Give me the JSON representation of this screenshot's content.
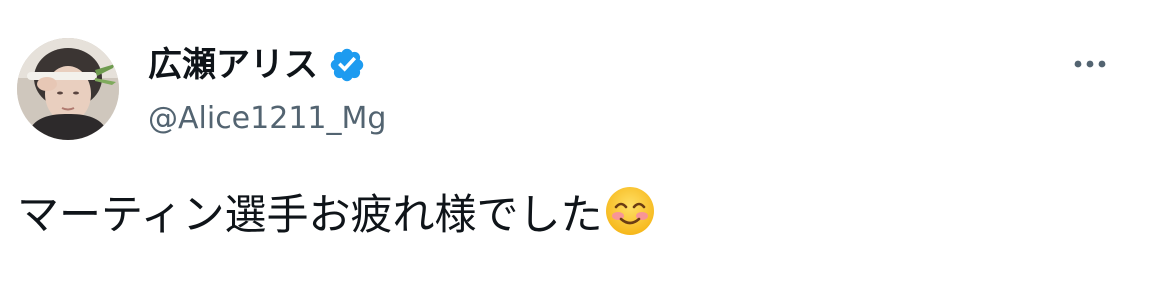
{
  "user": {
    "display_name": "広瀬アリス",
    "handle": "@Alice1211_Mg",
    "verified": true,
    "avatar_icon": "profile-photo"
  },
  "tweet": {
    "text": "マーティン選手お疲れ様でした",
    "emoji": "smiling-face-with-smiling-eyes-icon"
  },
  "menu": {
    "icon": "more-options-icon"
  },
  "colors": {
    "name": "#0f1419",
    "handle": "#536471",
    "verified_blue": "#1d9bf0",
    "background": "#ffffff"
  }
}
